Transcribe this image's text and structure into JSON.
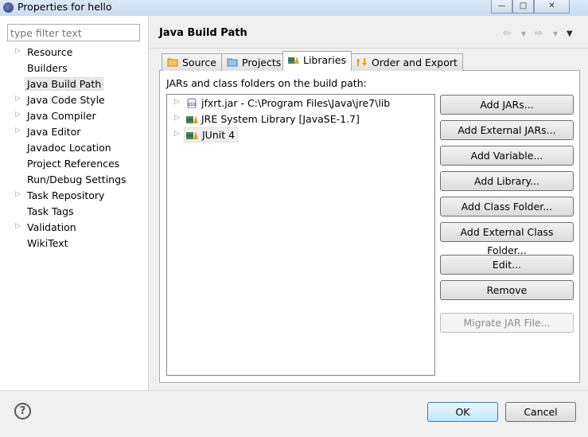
{
  "window": {
    "title": "Properties for hello"
  },
  "filter": {
    "placeholder": "type filter text"
  },
  "sidebar": {
    "items": [
      {
        "label": "Resource",
        "expandable": true
      },
      {
        "label": "Builders",
        "expandable": false
      },
      {
        "label": "Java Build Path",
        "expandable": false,
        "selected": true
      },
      {
        "label": "Java Code Style",
        "expandable": true
      },
      {
        "label": "Java Compiler",
        "expandable": true
      },
      {
        "label": "Java Editor",
        "expandable": true
      },
      {
        "label": "Javadoc Location",
        "expandable": false
      },
      {
        "label": "Project References",
        "expandable": false
      },
      {
        "label": "Run/Debug Settings",
        "expandable": false
      },
      {
        "label": "Task Repository",
        "expandable": true
      },
      {
        "label": "Task Tags",
        "expandable": false
      },
      {
        "label": "Validation",
        "expandable": true
      },
      {
        "label": "WikiText",
        "expandable": false
      }
    ]
  },
  "header": {
    "title": "Java Build Path"
  },
  "tabs": [
    {
      "label": "Source",
      "icon": "source-folder-icon"
    },
    {
      "label": "Projects",
      "icon": "projects-folder-icon"
    },
    {
      "label": "Libraries",
      "icon": "library-icon",
      "active": true
    },
    {
      "label": "Order and Export",
      "icon": "order-export-icon"
    }
  ],
  "libraries": {
    "label": "JARs and class folders on the build path:",
    "entries": [
      {
        "label": "jfxrt.jar - C:\\Program Files\\Java\\jre7\\lib",
        "icon": "jar-icon"
      },
      {
        "label": "JRE System Library [JavaSE-1.7]",
        "icon": "library-icon"
      },
      {
        "label": "JUnit 4",
        "icon": "library-icon",
        "selected": true
      }
    ],
    "buttons": [
      {
        "label": "Add JARs...",
        "enabled": true
      },
      {
        "label": "Add External JARs...",
        "enabled": true
      },
      {
        "label": "Add Variable...",
        "enabled": true
      },
      {
        "label": "Add Library...",
        "enabled": true
      },
      {
        "label": "Add Class Folder...",
        "enabled": true
      },
      {
        "label": "Add External Class Folder...",
        "enabled": true
      },
      {
        "label": "Edit...",
        "enabled": true
      },
      {
        "label": "Remove",
        "enabled": true
      },
      {
        "label": "Migrate JAR File...",
        "enabled": false
      }
    ]
  },
  "footer": {
    "help": "?",
    "ok": "OK",
    "cancel": "Cancel"
  }
}
